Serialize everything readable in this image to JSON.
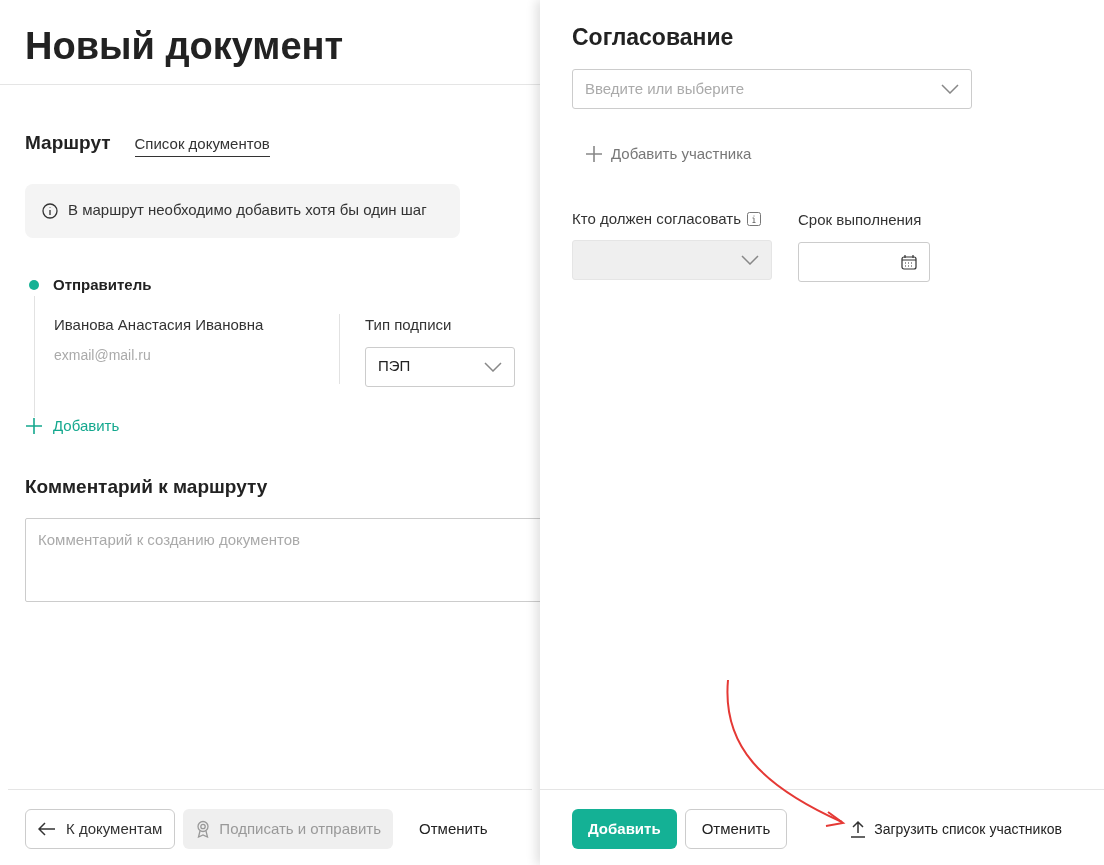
{
  "page": {
    "title": "Новый документ"
  },
  "route": {
    "title": "Маршрут",
    "link": "Список документов",
    "notice": "В маршрут необходимо добавить хотя бы один шаг",
    "steps": [
      {
        "title": "Отправитель",
        "name": "Иванова Анастасия Ивановна",
        "email": "exmail@mail.ru",
        "signature_label": "Тип подписи",
        "signature_value": "ПЭП"
      }
    ],
    "add": "Добавить"
  },
  "comment": {
    "title": "Комментарий к маршруту",
    "placeholder": "Комментарий к созданию документов"
  },
  "footer": {
    "buttons": [
      {
        "kind": "back",
        "label": "К документам",
        "disabled": false
      },
      {
        "kind": "sign",
        "label": "Подписать и отправить",
        "disabled": true
      },
      {
        "kind": "text",
        "label": "Отменить",
        "disabled": false
      }
    ]
  },
  "panel": {
    "title": "Согласование",
    "search_placeholder": "Введите или выберите",
    "add_participant": "Добавить участника",
    "approver_label": "Кто должен согласовать",
    "approver_disabled": true,
    "deadline_label": "Срок выполнения",
    "buttons": [
      {
        "kind": "primary",
        "label": "Добавить"
      },
      {
        "kind": "outline",
        "label": "Отменить"
      },
      {
        "kind": "upload",
        "label": "Загрузить список участников"
      }
    ]
  }
}
